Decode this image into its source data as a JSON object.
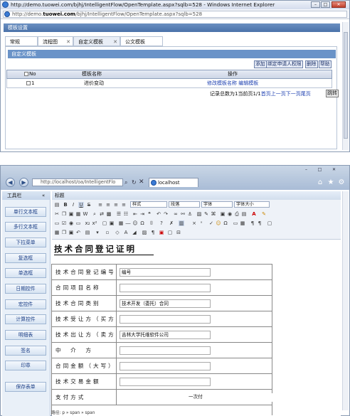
{
  "window1": {
    "title": "http://demo.tuowei.com/bjhj/IntelligentFlow/OpenTemplate.aspx?sqlb=528 - Windows Internet Explorer",
    "address_prefix": "http://demo.",
    "address_bold": "tuowei.com",
    "address_suffix": "/bjhj/IntelligentFlow/OpenTemplate.aspx?sqlb=528",
    "panel_title": "模板设置",
    "tabs": [
      {
        "label": "常规",
        "close": ""
      },
      {
        "label": "流程图",
        "close": "✕"
      },
      {
        "label": "自定义模板",
        "close": "✕"
      },
      {
        "label": "公文模板",
        "close": ""
      }
    ],
    "section_title": "自定义模板",
    "toolbar": {
      "add": "添加",
      "bind": "绑定申请人权限",
      "delete": "删除",
      "help": "帮助"
    },
    "table": {
      "headers": {
        "no": "No",
        "name": "模板名称",
        "action": "操作"
      },
      "rows": [
        {
          "no": "1",
          "name": "进价变动",
          "action_edit_name": "修改模板名称",
          "action_edit_template": "编辑模板"
        }
      ]
    },
    "pager": {
      "text": "记录总数为1当前页1/1",
      "first": "首页",
      "prev": "上一页",
      "next": "下一页",
      "last": "尾页",
      "go": "跳转"
    }
  },
  "window2": {
    "address": "http://localhost/oa/IntelligentFlo",
    "tab_title": "localhost",
    "left_title": "工具栏",
    "collapse": "«",
    "left_buttons": [
      "单行文本框",
      "多行文本框",
      "下拉菜单",
      "复选框",
      "单选框",
      "日期控件",
      "宏控件",
      "计算控件",
      "明细表",
      "签名",
      "印章",
      "保存表单"
    ],
    "editor_header": "标题",
    "toolbar_selects": {
      "style": "样式",
      "format": "段落",
      "font": "字体",
      "size": "字体大小"
    },
    "doc_title": "技术合同登记证明",
    "form_rows": [
      {
        "label": "技术合同登记编号",
        "value": "编号"
      },
      {
        "label": "合同项目名称",
        "value": ""
      },
      {
        "label": "技术合同类别",
        "value": "技术开发（委托）合同"
      },
      {
        "label": "技术受让方（买方）",
        "value": ""
      },
      {
        "label": "技术出让方（卖方）",
        "value": "吉林大学托维软件公司"
      },
      {
        "label": "中　介　方",
        "value": ""
      },
      {
        "label": "合同金额（大写）",
        "value": ""
      },
      {
        "label": "技术交易金额",
        "value": ""
      },
      {
        "label": "支付方式",
        "value": "一次付"
      }
    ],
    "status": "路径: p » span » span"
  }
}
